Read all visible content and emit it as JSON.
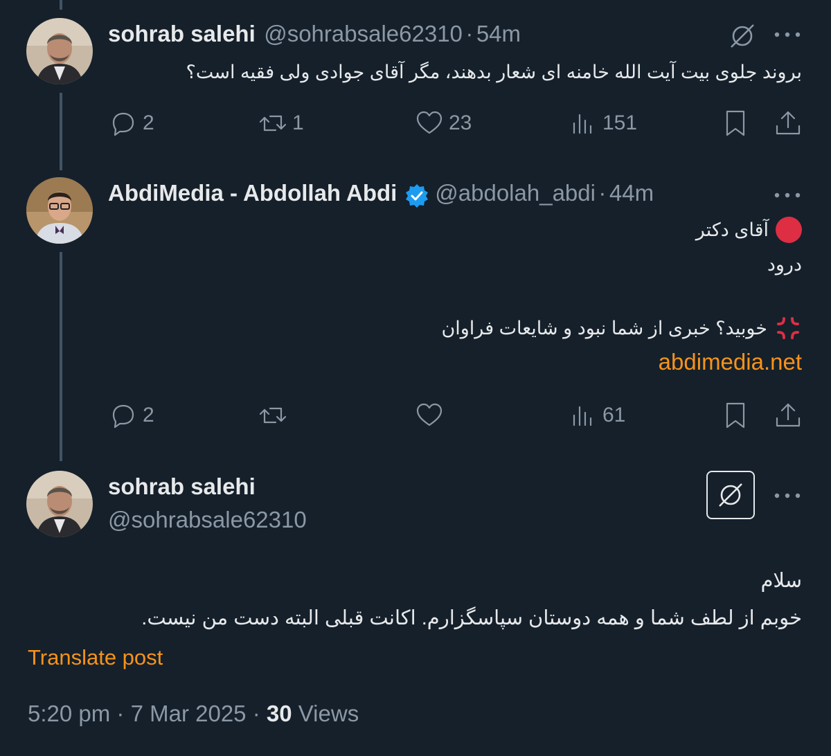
{
  "tweets": [
    {
      "name": "sohrab salehi",
      "handle": "@sohrabsale62310",
      "sep": "·",
      "time": "54m",
      "text": "بروند جلوی بیت آیت الله خامنه ای شعار بدهند، مگر آقای جوادی ولی فقیه است؟",
      "replies": "2",
      "reposts": "1",
      "likes": "23",
      "views": "151"
    },
    {
      "name": "AbdiMedia - Abdollah Abdi",
      "handle": "@abdolah_abdi",
      "sep": "·",
      "time": "44m",
      "line1": "آقای دکتر",
      "line2": "درود",
      "line3": "خوبید؟ خبری از شما نبود و شایعات فراوان",
      "link": "abdimedia.net",
      "replies": "2",
      "reposts": "",
      "likes": "",
      "views": "61"
    }
  ],
  "main": {
    "name": "sohrab salehi",
    "handle": "@sohrabsale62310",
    "line1": "سلام",
    "line2": "خوبم از لطف شما و  همه دوستان سپاسگزارم. اکانت قبلی البته دست من نیست.",
    "translate": "Translate post",
    "time": "5:20 pm",
    "sep1": "·",
    "date": "7 Mar 2025",
    "sep2": "·",
    "views_count": "30",
    "views_label": "Views"
  },
  "colors": {
    "background": "#15202b",
    "accent_link": "#f7931a",
    "verified_blue": "#1d9bf0",
    "muted": "#8b98a5",
    "red_circle": "#dd2e44"
  },
  "icons": [
    "reply-icon",
    "repost-icon",
    "like-icon",
    "views-icon",
    "bookmark-icon",
    "share-icon",
    "more-icon",
    "grok-icon",
    "verified-badge-icon",
    "red-circle-emoji",
    "anger-emoji"
  ]
}
